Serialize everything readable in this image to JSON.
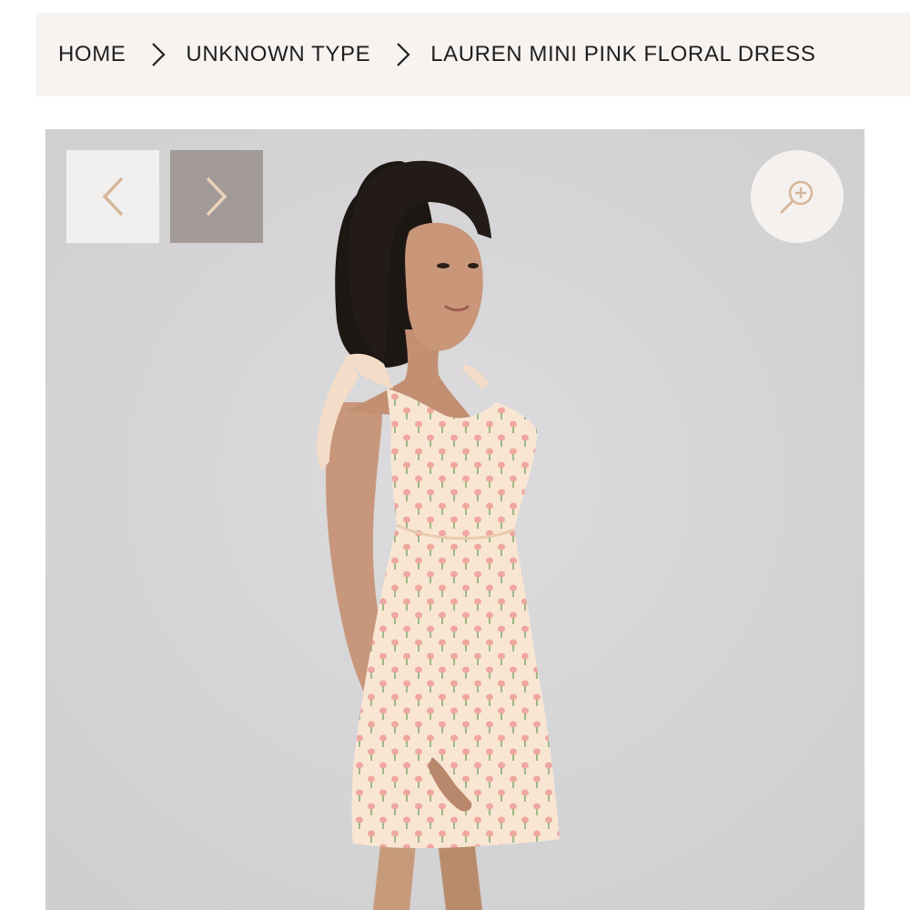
{
  "breadcrumb": {
    "items": [
      {
        "label": "HOME"
      },
      {
        "label": "UNKNOWN TYPE"
      },
      {
        "label": "LAUREN MINI PINK FLORAL DRESS"
      }
    ],
    "separator_icon": "chevron-right-icon"
  },
  "gallery": {
    "prev_icon": "chevron-left-icon",
    "next_icon": "chevron-right-icon",
    "zoom_icon": "zoom-in-icon",
    "background_color": "#d3d2d4",
    "arrow_color": "#d6b79b"
  }
}
